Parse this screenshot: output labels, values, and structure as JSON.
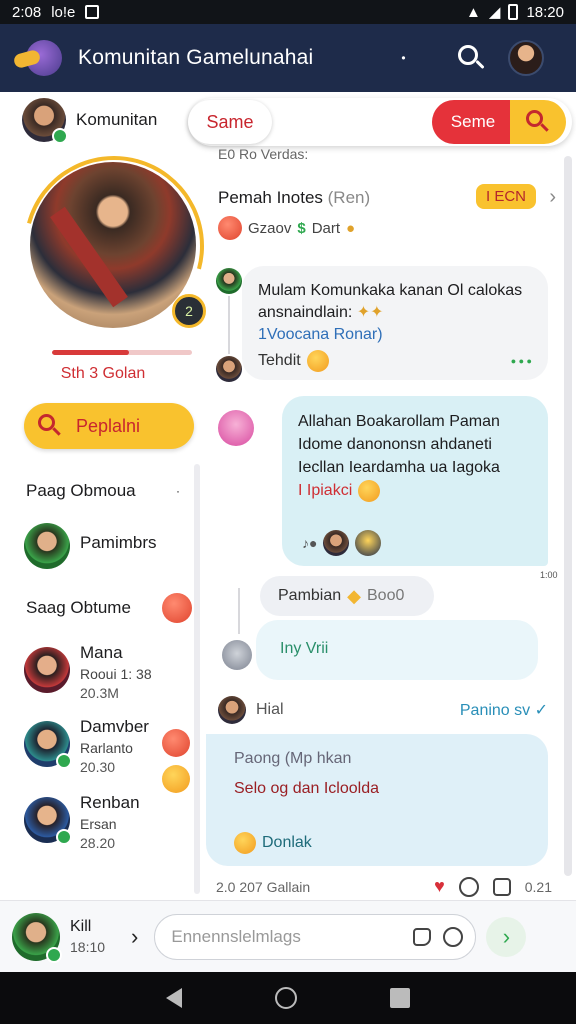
{
  "status_bar": {
    "time": "2:08",
    "carrier": "lo!e",
    "clock_right": "18:20"
  },
  "header": {
    "title": "Komunitan Gamelunahai",
    "search_icon": "search-icon",
    "avatar_icon": "avatar"
  },
  "left": {
    "top_name": "Komunitan",
    "hero": {
      "level": "2",
      "name": "Sth 3 Golan",
      "xp_fraction": 0.55
    },
    "search_button": "Peplalni",
    "section1": "Paag Obmoua",
    "contacts_a": [
      {
        "name": "Pamimbrs"
      }
    ],
    "section2": "Saag Obtume",
    "contacts_b": [
      {
        "name": "Mana",
        "sub": "Rooui 1: 38",
        "time": "20.3M"
      },
      {
        "name": "Damvber",
        "sub": "Rarlanto",
        "time": "20.30"
      },
      {
        "name": "Renban",
        "sub": "Ersan",
        "time": "28.20"
      }
    ]
  },
  "right": {
    "tabs": {
      "same_left": "Same",
      "same_right": "Seme"
    },
    "sub_header": "E0 Ro Verdas:",
    "card": {
      "title": "Pemah Inotes",
      "title_muted": "(Ren)",
      "badge": "I ECN",
      "meta1": "Gzaov",
      "meta2": "Dart"
    },
    "msg1": {
      "line1": "Mulam Komunkaka kanan Ol calokas",
      "line2": "ansnaindlain:",
      "line3": "1Voocana Ronar)",
      "status": "Tehdit"
    },
    "msg2": {
      "line1": "Allahan Boakarollam Paman",
      "line2": "Idome danononsn ahdaneti",
      "line3": "Iecllan Ieardamha ua Iagoka",
      "line4": "I Ipiakci",
      "time": "1:00"
    },
    "msg3": {
      "text": "Pambian",
      "tag": "Boo0"
    },
    "msg4": {
      "text": "Iny Vrii"
    },
    "row": {
      "left": "Hial",
      "right": "Panino sv"
    },
    "msg5": {
      "line1": "Paong (Mp hkan",
      "line2": "Selo og dan Icloolda",
      "foot": "Donlak"
    },
    "footer": {
      "time": "2.0 207 Gallain",
      "count": "0.21"
    }
  },
  "composer": {
    "name": "Kill",
    "time": "18:10",
    "placeholder": "Ennennslelmlags"
  },
  "colors": {
    "header_bg": "#1e2b4a",
    "accent_yellow": "#f9c22e",
    "accent_red": "#e5323a",
    "bubble_teal": "#d9f0f5"
  }
}
